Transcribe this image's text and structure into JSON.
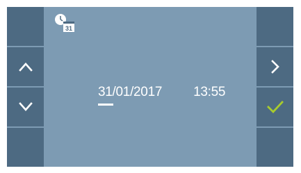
{
  "mode_icon": "clock-calendar-icon",
  "mode_icon_text": "31",
  "date": {
    "day": "31",
    "month": "/01",
    "year": "/2017"
  },
  "time": "13:55",
  "left_buttons": [
    {
      "icon": "blank"
    },
    {
      "icon": "chevron-up-icon"
    },
    {
      "icon": "chevron-down-icon"
    },
    {
      "icon": "blank"
    }
  ],
  "right_buttons": [
    {
      "icon": "blank"
    },
    {
      "icon": "chevron-right-icon"
    },
    {
      "icon": "checkmark-icon"
    },
    {
      "icon": "blank"
    }
  ],
  "colors": {
    "screen_bg": "#7d9bb3",
    "button_bg": "#4d6a82",
    "text": "#ffffff",
    "confirm": "#a9cc2c"
  }
}
